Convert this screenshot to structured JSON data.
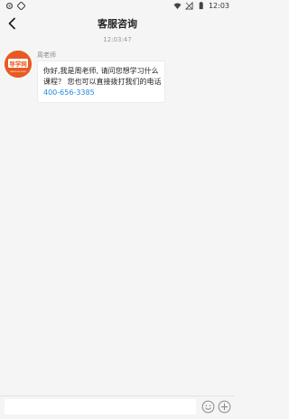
{
  "status_bar": {
    "time": "12:03"
  },
  "nav": {
    "title": "客服咨询"
  },
  "chat": {
    "timestamp": "12:03:47",
    "messages": [
      {
        "sender": "周老师",
        "lines": [
          "你好,我是周老师, 请问您想学习什么",
          "课程？ 您也可以直接拨打我们的电话"
        ],
        "phone": "400-656-3385",
        "avatar_logo_text": "导学网",
        "avatar_logo_subtext": "daoxue.com"
      }
    ]
  },
  "input": {
    "value": "",
    "placeholder": ""
  },
  "icons": {
    "back": "chevron-left-icon",
    "emoji": "emoji-icon",
    "plus": "plus-circle-icon"
  },
  "colors": {
    "background": "#f5f5f5",
    "phone_link": "#1e88e5",
    "avatar_brand": "#e85a23"
  }
}
